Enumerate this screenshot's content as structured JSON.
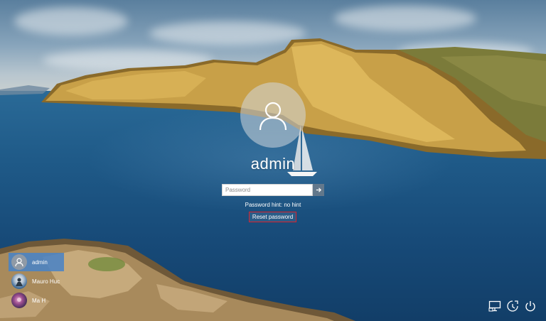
{
  "login": {
    "username": "admin",
    "password_placeholder": "Password",
    "password_value": "",
    "hint": "Password hint: no hint",
    "reset_label": "Reset password"
  },
  "users": [
    {
      "name": "admin",
      "selected": true,
      "avatar": "default-user-icon"
    },
    {
      "name": "Mauro Huc",
      "selected": false,
      "avatar": "profile-photo"
    },
    {
      "name": "Ma H",
      "selected": false,
      "avatar": "profile-photo"
    }
  ],
  "system_icons": [
    "network-icon",
    "ease-of-access-icon",
    "power-icon"
  ],
  "colors": {
    "reset_border": "#d9232d",
    "selected_user": "#4682c8",
    "submit_button": "#78828c"
  }
}
